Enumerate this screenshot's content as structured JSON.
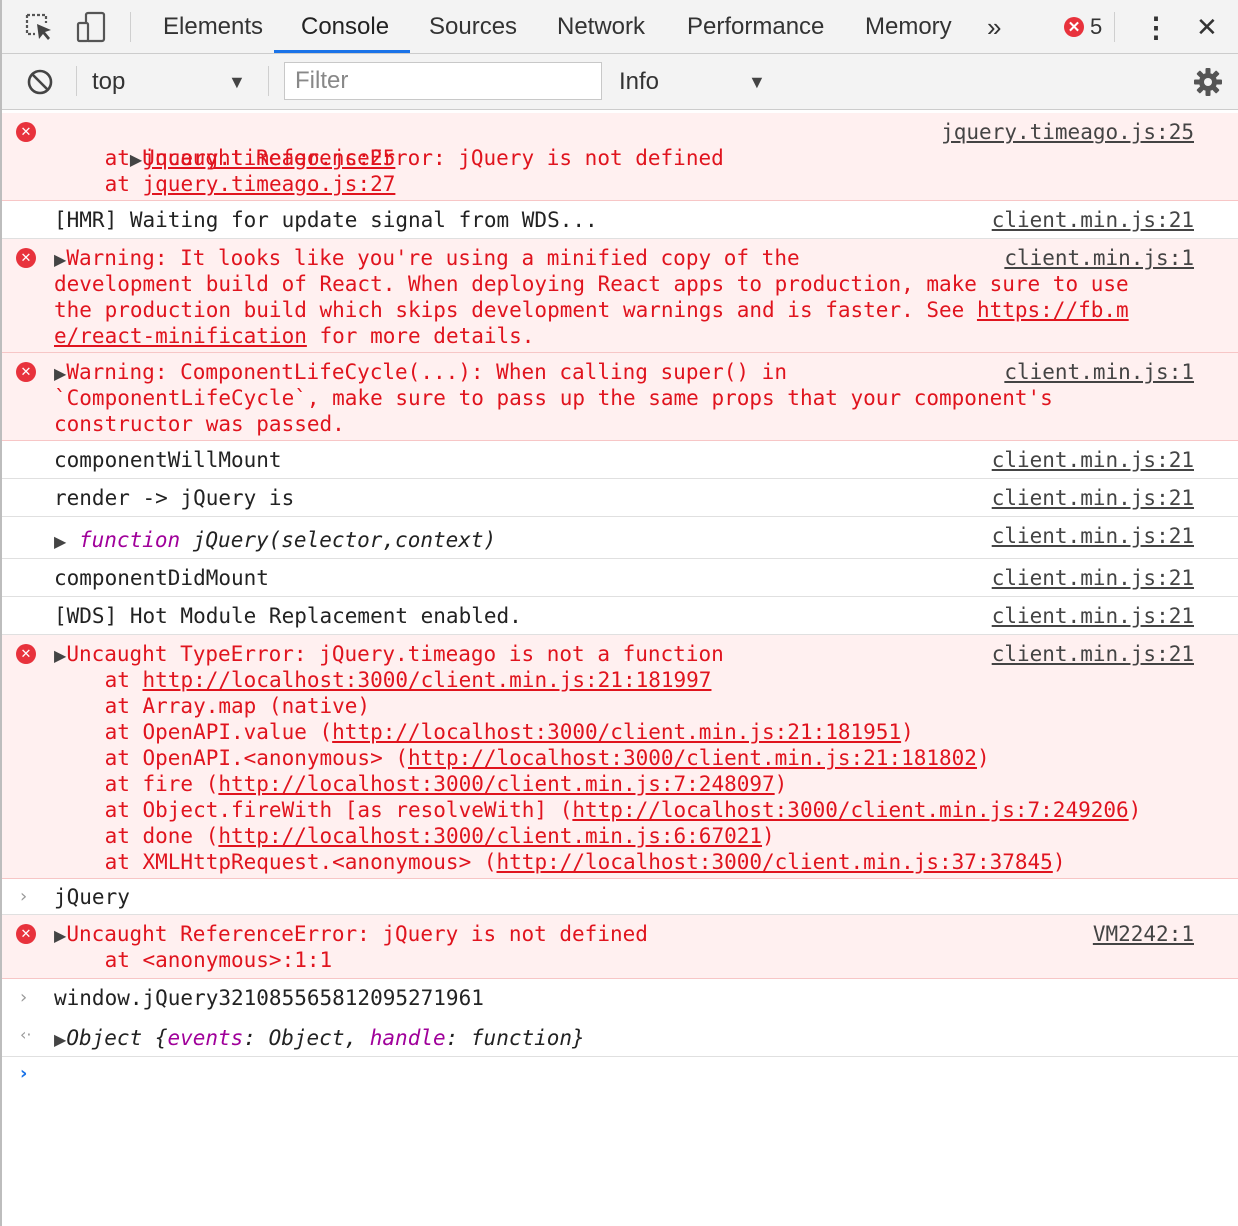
{
  "toolbar": {
    "tabs": [
      "Elements",
      "Console",
      "Sources",
      "Network",
      "Performance",
      "Memory"
    ],
    "more": "»",
    "error_count": "5",
    "menu": "⋮",
    "close": "✕"
  },
  "filterbar": {
    "context": "top",
    "filter_placeholder": "Filter",
    "level": "Info"
  },
  "messages": {
    "m1": {
      "text": "Uncaught ReferenceError: jQuery is not defined",
      "stack1_prefix": "    at ",
      "stack1_link": "jquery.timeago.js:25",
      "stack2_prefix": "    at ",
      "stack2_link": "jquery.timeago.js:27",
      "source": "jquery.timeago.js:25"
    },
    "m2": {
      "text": "[HMR] Waiting for update signal from WDS...",
      "source": "client.min.js:21"
    },
    "m3": {
      "line1": "Warning: It looks like you're using a minified copy of the",
      "line2": "development build of React. When deploying React apps to production, make sure to use",
      "line3_text": "the production build which skips development warnings and is faster. See ",
      "line3_link": "https://fb.m",
      "line4_link": "e/react-minification",
      "line4_text": " for more details.",
      "source": "client.min.js:1"
    },
    "m4": {
      "line1": "Warning: ComponentLifeCycle(...): When calling super() in",
      "line2": "`ComponentLifeCycle`, make sure to pass up the same props that your component's",
      "line3": "constructor was passed.",
      "source": "client.min.js:1"
    },
    "m5": {
      "text": "componentWillMount",
      "source": "client.min.js:21"
    },
    "m6": {
      "text": "render -> jQuery is",
      "source": "client.min.js:21"
    },
    "m7": {
      "keyword": "function",
      "text": " jQuery(selector,context)",
      "source": "client.min.js:21"
    },
    "m8": {
      "text": "componentDidMount",
      "source": "client.min.js:21"
    },
    "m9": {
      "text": "[WDS] Hot Module Replacement enabled.",
      "source": "client.min.js:21"
    },
    "m10": {
      "text": "Uncaught TypeError: jQuery.timeago is not a function",
      "source": "client.min.js:21",
      "s1_pre": "    at ",
      "s1_link": "http://localhost:3000/client.min.js:21:181997",
      "s1_post": "",
      "s2_pre": "    at Array.map (native)",
      "s3_pre": "    at OpenAPI.value (",
      "s3_link": "http://localhost:3000/client.min.js:21:181951",
      "s3_post": ")",
      "s4_pre": "    at OpenAPI.<anonymous> (",
      "s4_link": "http://localhost:3000/client.min.js:21:181802",
      "s4_post": ")",
      "s5_pre": "    at fire (",
      "s5_link": "http://localhost:3000/client.min.js:7:248097",
      "s5_post": ")",
      "s6_pre": "    at Object.fireWith [as resolveWith] (",
      "s6_link": "http://localhost:3000/client.min.js:7:249206",
      "s6_post": ")",
      "s7_pre": "    at done (",
      "s7_link": "http://localhost:3000/client.min.js:6:67021",
      "s7_post": ")",
      "s8_pre": "    at XMLHttpRequest.<anonymous> (",
      "s8_link": "http://localhost:3000/client.min.js:37:37845",
      "s8_post": ")"
    },
    "m11": {
      "text": "jQuery"
    },
    "m12": {
      "text": "Uncaught ReferenceError: jQuery is not defined",
      "stack": "    at <anonymous>:1:1",
      "source": "VM2242:1"
    },
    "m13": {
      "text": "window.jQuery3210855658120952719 61"
    },
    "m14": {
      "p1": "Object {",
      "k1": "events",
      "p2": ": Object, ",
      "k2": "handle",
      "p3": ": function}"
    }
  }
}
